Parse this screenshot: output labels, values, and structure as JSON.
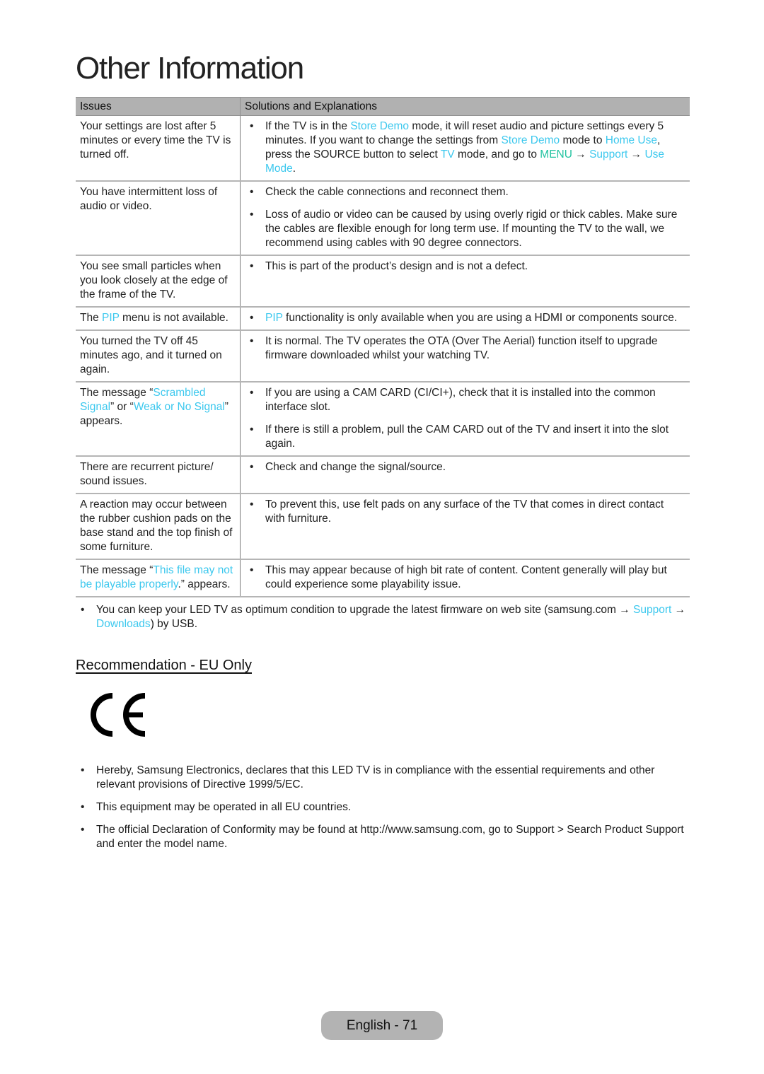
{
  "page": {
    "title": "Other Information",
    "footer_label": "English - 71"
  },
  "colors": {
    "highlight": "#3cc8ee",
    "menu_highlight": "#22c3a0",
    "table_header": "#b1b1b1",
    "footer_badge": "#b3b3b3"
  },
  "table": {
    "headers": {
      "issues": "Issues",
      "solutions": "Solutions and Explanations"
    },
    "rows": [
      {
        "issue": [
          {
            "t": "Your settings are lost after 5 minutes or every time the TV is turned off."
          }
        ],
        "solutions": [
          [
            {
              "t": "If the TV is in the "
            },
            {
              "t": "Store Demo",
              "hl": true
            },
            {
              "t": " mode, it will reset audio and picture settings every 5 minutes. If you want to change the settings from "
            },
            {
              "t": "Store Demo",
              "hl": true
            },
            {
              "t": " mode to "
            },
            {
              "t": "Home Use",
              "hl": true
            },
            {
              "t": ", press the SOURCE button to select "
            },
            {
              "t": "TV",
              "hl": true
            },
            {
              "t": " mode, and go to "
            },
            {
              "t": "MENU",
              "hl": "green"
            },
            {
              "t": " → "
            },
            {
              "t": "Support",
              "hl": true
            },
            {
              "t": " → "
            },
            {
              "t": "Use Mode",
              "hl": true
            },
            {
              "t": "."
            }
          ]
        ]
      },
      {
        "issue": [
          {
            "t": "You have intermittent loss of audio or video."
          }
        ],
        "solutions": [
          [
            {
              "t": "Check the cable connections and reconnect them."
            }
          ],
          [
            {
              "t": "Loss of audio or video can be caused by using overly rigid or thick cables. Make sure the cables are flexible enough for long term use. If mounting the TV to the wall, we recommend using cables with 90 degree connectors."
            }
          ]
        ]
      },
      {
        "issue": [
          {
            "t": "You see small particles when you look closely at the edge of the frame of the TV."
          }
        ],
        "solutions": [
          [
            {
              "t": "This is part of the product’s design and is not a defect."
            }
          ]
        ]
      },
      {
        "issue": [
          {
            "t": "The "
          },
          {
            "t": "PIP",
            "hl": true
          },
          {
            "t": " menu is not available."
          }
        ],
        "solutions": [
          [
            {
              "t": "PIP",
              "hl": true
            },
            {
              "t": " functionality is only available when you are using a HDMI or components source."
            }
          ]
        ]
      },
      {
        "issue": [
          {
            "t": "You turned the TV off 45 minutes ago, and it turned on again."
          }
        ],
        "solutions": [
          [
            {
              "t": "It is normal. The TV operates the OTA (Over The Aerial) function itself to upgrade firmware downloaded whilst your watching TV."
            }
          ]
        ]
      },
      {
        "issue": [
          {
            "t": "The message “"
          },
          {
            "t": "Scrambled Signal",
            "hl": true
          },
          {
            "t": "” or “"
          },
          {
            "t": "Weak or No Signal",
            "hl": true
          },
          {
            "t": "” appears."
          }
        ],
        "solutions": [
          [
            {
              "t": "If you are using a CAM CARD (CI/CI+), check that it is installed into the common interface slot."
            }
          ],
          [
            {
              "t": "If there is still a problem, pull the CAM CARD out of the TV and insert it into the slot again."
            }
          ]
        ]
      },
      {
        "issue": [
          {
            "t": "There are recurrent picture/ sound issues."
          }
        ],
        "solutions": [
          [
            {
              "t": "Check and change the signal/source."
            }
          ]
        ]
      },
      {
        "issue": [
          {
            "t": "A reaction may occur between the rubber cushion pads on the base stand and the top finish of some furniture."
          }
        ],
        "solutions": [
          [
            {
              "t": "To prevent this, use felt pads on any surface of the TV that comes in direct contact with furniture."
            }
          ]
        ]
      },
      {
        "issue": [
          {
            "t": "The message “"
          },
          {
            "t": "This file may not be playable properly",
            "hl": true
          },
          {
            "t": ".” appears."
          }
        ],
        "solutions": [
          [
            {
              "t": "This may appear because of high bit rate of content. Content generally will play but could experience some playability issue."
            }
          ]
        ]
      }
    ]
  },
  "note": [
    {
      "t": "You can keep your LED TV as optimum condition to upgrade the latest firmware on web site (samsung.com → "
    },
    {
      "t": "Support",
      "hl": true
    },
    {
      "t": " → "
    },
    {
      "t": "Downloads",
      "hl": true
    },
    {
      "t": ") by USB."
    }
  ],
  "eu_section": {
    "heading": "Recommendation - EU Only",
    "mark_icon": "ce-mark-icon",
    "items": [
      "Hereby, Samsung Electronics, declares that this LED TV is in compliance with the essential requirements and other relevant provisions of Directive 1999/5/EC.",
      "This equipment may be operated in all EU countries.",
      "The official Declaration of Conformity may be found at http://www.samsung.com, go to Support > Search Product Support and enter the model name."
    ]
  }
}
